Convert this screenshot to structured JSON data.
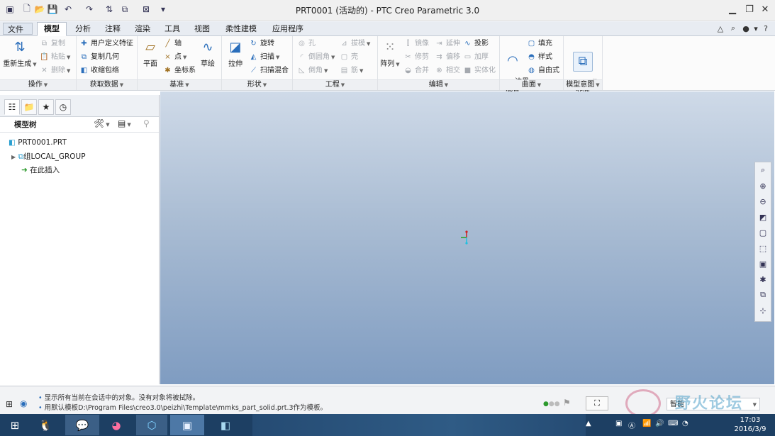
{
  "window": {
    "title": "PRT0001 (活动的) - PTC Creo Parametric 3.0",
    "minimize": "▁",
    "maximize": "❐",
    "close": "✕"
  },
  "tabs": [
    "文件",
    "模型",
    "分析",
    "注释",
    "渲染",
    "工具",
    "视图",
    "柔性建模",
    "应用程序"
  ],
  "ribbon": {
    "groups": {
      "ops": "操作",
      "data": "获取数据",
      "datum": "基准",
      "shapes": "形状",
      "eng": "工程",
      "edit": "编辑",
      "surface": "曲面",
      "intent": "模型意图"
    },
    "ops": {
      "regen": "重新生成",
      "copy": "复制",
      "paste": "粘贴",
      "delete": "删除"
    },
    "data": {
      "udf": "用户定义特征",
      "copygeom": "复制几何",
      "shrink": "收缩包络"
    },
    "datum": {
      "plane": "平面",
      "axis": "轴",
      "point": "点",
      "csys": "坐标系",
      "sketch": "草绘"
    },
    "shapes": {
      "extrude": "拉伸",
      "revolve": "旋转",
      "sweep": "扫描",
      "swept_blend": "扫描混合"
    },
    "eng": {
      "hole": "孔",
      "round": "倒圆角",
      "chamfer": "倒角",
      "draft": "拔模",
      "shell": "壳",
      "rib": "筋"
    },
    "edit": {
      "pattern": "阵列",
      "mirror": "镜像",
      "trim": "修剪",
      "merge": "合并",
      "extend": "延伸",
      "offset": "偏移",
      "intersect": "相交",
      "project": "投影",
      "thicken": "加厚",
      "solidify": "实体化"
    },
    "surface": {
      "boundary": "边界\n混合",
      "fill": "填充",
      "style": "样式",
      "freestyle": "自由式"
    },
    "intent": {
      "component": "元件\n界面"
    }
  },
  "leftpanel": {
    "tree_title": "模型树",
    "items": [
      "PRT0001.PRT",
      "组LOCAL_GROUP",
      "在此插入"
    ]
  },
  "status": {
    "messages": [
      "显示所有当前在会话中的对象。没有对象将被拭除。",
      "用默认模板D:\\Program Files\\creo3.0\\peizhi\\Template\\mmks_part_solid.prt.3作为模板。"
    ],
    "filter": "智能"
  },
  "watermark": "野火论坛",
  "taskbar": {
    "time": "17:03",
    "date": "2016/3/9"
  },
  "colors": {
    "accent": "#2a6ebb",
    "taskbar": "#1d3f63",
    "viewport_top": "#cfdae8",
    "viewport_bottom": "#7f9cc1"
  }
}
